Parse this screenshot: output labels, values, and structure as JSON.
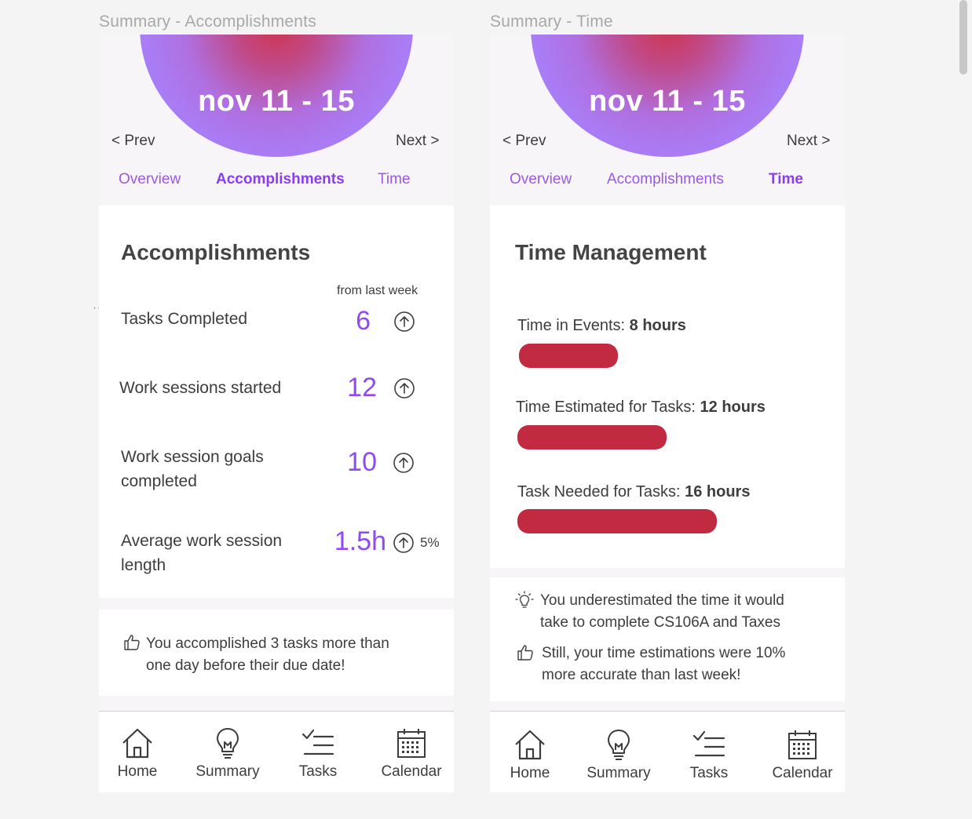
{
  "frames": {
    "left_label": "Summary - Accomplishments",
    "right_label": "Summary - Time"
  },
  "header": {
    "date_range": "nov 11 - 15",
    "prev": "< Prev",
    "next": "Next >"
  },
  "tabs": {
    "overview": "Overview",
    "accomplishments": "Accomplishments",
    "time": "Time"
  },
  "accomplishments": {
    "title": "Accomplishments",
    "from_last_week": "from last week",
    "rows": [
      {
        "label_lines": [
          "Tasks Completed"
        ],
        "value": "6",
        "change": ""
      },
      {
        "label_lines": [
          "Work sessions started"
        ],
        "value": "12",
        "change": ""
      },
      {
        "label_lines": [
          "Work session goals",
          "completed"
        ],
        "value": "10",
        "change": ""
      },
      {
        "label_lines": [
          "Average work session",
          "length"
        ],
        "value": "1.5h",
        "change": "5%"
      }
    ],
    "tip_lines": [
      "You accomplished 3 tasks more than",
      "one day before their due date!"
    ]
  },
  "time": {
    "title": "Time Management",
    "bars": [
      {
        "label": "Time in Events: ",
        "amount": "8 hours",
        "hours": 8
      },
      {
        "label": "Time Estimated for Tasks: ",
        "amount": "12 hours",
        "hours": 12
      },
      {
        "label": "Task Needed for Tasks: ",
        "amount": "16 hours",
        "hours": 16
      }
    ],
    "tip1_lines": [
      "You underestimated the time it would",
      "take to complete CS106A and Taxes"
    ],
    "tip2_lines": [
      "Still, your time estimations were 10%",
      "more accurate than last week!"
    ]
  },
  "bottom_nav": {
    "home": "Home",
    "summary": "Summary",
    "tasks": "Tasks",
    "calendar": "Calendar"
  },
  "colors": {
    "accent": "#8f4bf0",
    "bar": "#c22a42",
    "hero_center": "#d0354f",
    "hero_edge": "#a57ef8"
  }
}
